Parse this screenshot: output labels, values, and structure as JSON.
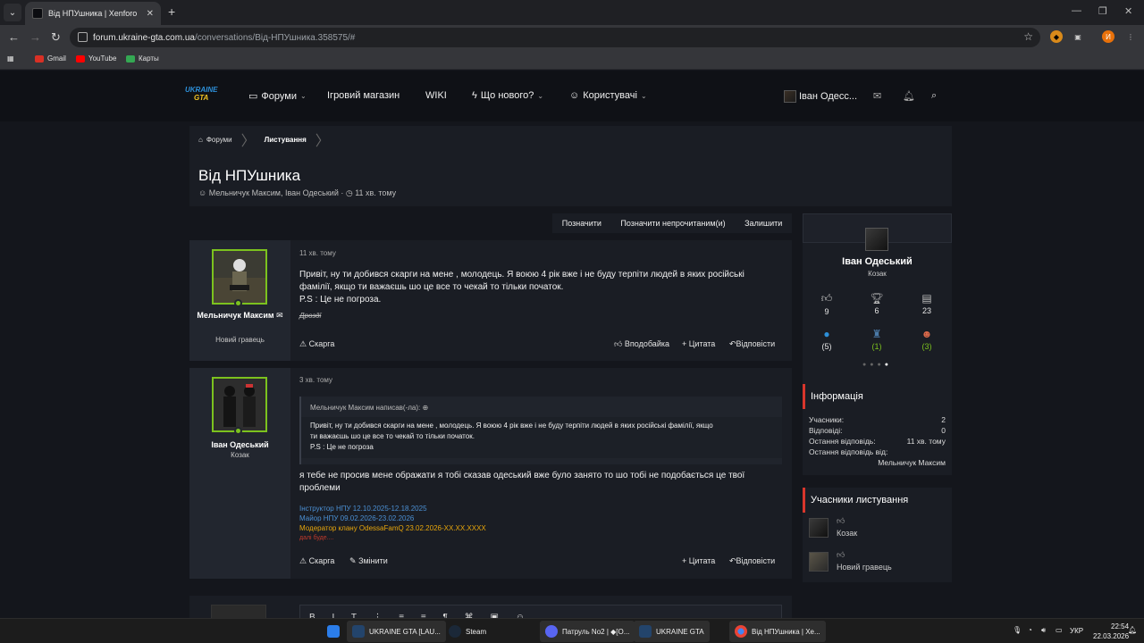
{
  "browser": {
    "tab_title": "Від НПУшника | Xenforo",
    "url_host": "forum.ukraine-gta.com.ua",
    "url_path": "/conversations/Від-НПУшника.358575/#",
    "profile_letter": "И",
    "bookmarks": [
      "Gmail",
      "YouTube",
      "Карты"
    ]
  },
  "header": {
    "logo_line1": "UKRAINE",
    "logo_line2": "GTA",
    "nav": [
      "Форуми",
      "Ігровий магазин",
      "WIKI",
      "Що нового?",
      "Користувачі"
    ],
    "user": "Іван Одесс..."
  },
  "breadcrumb": {
    "home": "Форуми",
    "current": "Листування"
  },
  "page": {
    "title": "Від НПУшника",
    "participants": "Мельничук Максим, Іван Одеський",
    "age": "11 хв. тому"
  },
  "actions": {
    "mark": "Позначити",
    "mark_unread": "Позначити непрочитаним(и)",
    "leave": "Залишити"
  },
  "messages": [
    {
      "author": "Мельничук Максим",
      "title": "Новий гравець",
      "time": "11 хв. тому",
      "line1": "Привіт, ну ти добився скарги на мене , молодець. Я воюю 4 рік вже і не буду терпіти людей в яких російські",
      "line2": "фамілії, якщо ти важаєшь шо це все то чекай то тільки початок.",
      "line3": "P.S : Це не погроза.",
      "signature": "Дроздї",
      "report": "Скарга",
      "like": "Вподобайка",
      "quote": "Цитата",
      "reply": "Відповісти"
    },
    {
      "author": "Іван Одеський",
      "title": "Козак",
      "time": "3 хв. тому",
      "quote_head": "Мельничук Максим написав(-ла):",
      "quote_line1": "Привіт, ну ти добився скарги на мене , молодець. Я воюю 4 рік вже і не буду терпіти людей в яких російські фамілії, якщо",
      "quote_line2": "ти важаєшь шо це все то чекай то тільки початок.",
      "quote_line3": "P.S : Це не погроза",
      "line1": "я тебе не просив мене ображати я тобі сказав одеський вже було занято то шо тобі не подобається це твої",
      "line2": "проблеми",
      "sig1": "Інструктор НПУ 12.10.2025-12.18.2025",
      "sig2": "Майор НПУ 09.02.2026-23.02.2026",
      "sig3": "Модератор клану OdessaFamQ 23.02.2026-XX.XX.XXXX",
      "sig4": "далі буде....",
      "report": "Скарга",
      "edit": "Змінити",
      "quote": "Цитата",
      "reply": "Відповісти"
    }
  ],
  "profile_card": {
    "name": "Іван Одеський",
    "title": "Козак",
    "stats": [
      "9",
      "6",
      "23"
    ],
    "reactions": [
      "(5)",
      "(1)",
      "(3)"
    ]
  },
  "info": {
    "heading": "Інформація",
    "rows": [
      {
        "k": "Учасники:",
        "v": "2"
      },
      {
        "k": "Відповіді:",
        "v": "0"
      },
      {
        "k": "Остання відповідь:",
        "v": "11 хв. тому"
      },
      {
        "k": "Остання відповідь від:",
        "v": ""
      }
    ],
    "last_by": "Мельничук Максим"
  },
  "participants_block": {
    "heading": "Учасники листування",
    "items": [
      "Козак",
      "Новий гравець"
    ]
  },
  "taskbar": {
    "items": [
      "UKRAINE GTA [LAU...",
      "Steam",
      "Патруль No2 | ◆[O...",
      "UKRAINE GTA",
      "Від НПУшника | Xe..."
    ],
    "lang": "УКР",
    "time": "22:54",
    "date": "22.03.2026"
  }
}
